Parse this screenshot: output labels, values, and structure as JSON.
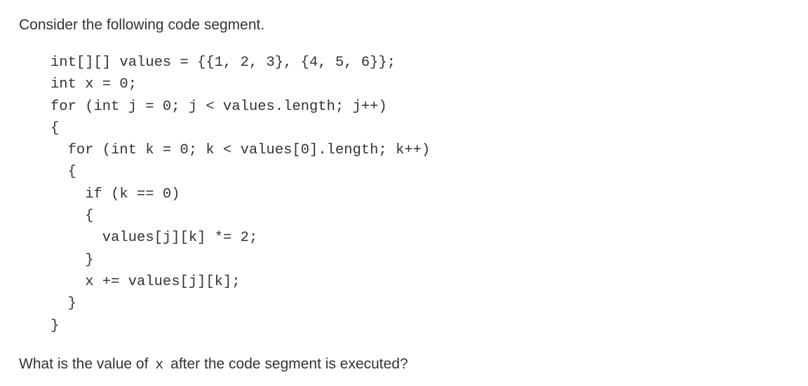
{
  "intro": "Consider the following code segment.",
  "code_lines": [
    "int[][] values = {{1, 2, 3}, {4, 5, 6}};",
    "int x = 0;",
    "for (int j = 0; j < values.length; j++)",
    "{",
    "  for (int k = 0; k < values[0].length; k++)",
    "  {",
    "    if (k == 0)",
    "    {",
    "      values[j][k] *= 2;",
    "    }",
    "    x += values[j][k];",
    "  }",
    "}"
  ],
  "question": {
    "before": "What is the value of",
    "code": "x",
    "after": "after the code segment is executed?"
  }
}
